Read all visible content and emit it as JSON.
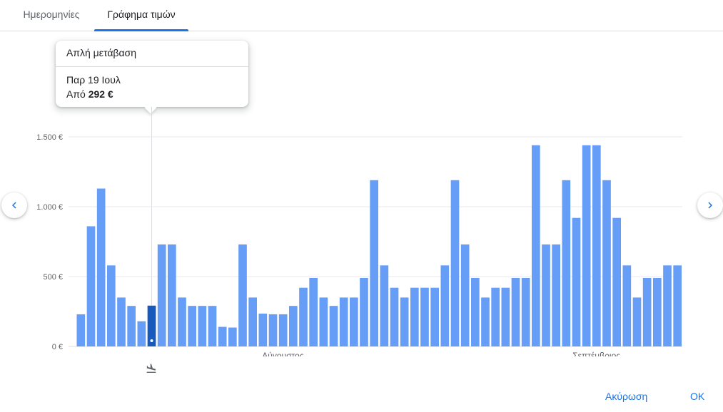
{
  "tabs": [
    {
      "label": "Ημερομηνίες",
      "active": false
    },
    {
      "label": "Γράφημα τιμών",
      "active": true
    }
  ],
  "tooltip": {
    "title": "Απλή μετάβαση",
    "date": "Παρ 19 Ιουλ",
    "price_prefix": "Από",
    "price": "292 €"
  },
  "nav": {
    "prev_icon": "chevron-left-icon",
    "next_icon": "chevron-right-icon"
  },
  "footer": {
    "cancel_label": "Ακύρωση",
    "ok_label": "OK"
  },
  "colors": {
    "bar": "#669df6",
    "bar_selected": "#185abc",
    "accent": "#1a73e8",
    "grid": "#e8eaed"
  },
  "chart_data": {
    "type": "bar",
    "values": [
      230,
      860,
      1130,
      580,
      350,
      290,
      180,
      292,
      730,
      730,
      350,
      290,
      290,
      290,
      140,
      135,
      730,
      350,
      235,
      230,
      230,
      290,
      420,
      490,
      350,
      290,
      350,
      350,
      490,
      1190,
      580,
      420,
      350,
      420,
      420,
      420,
      580,
      1190,
      730,
      490,
      350,
      420,
      420,
      490,
      490,
      1440,
      730,
      730,
      1190,
      920,
      1440,
      1440,
      1190,
      920,
      580,
      350,
      490,
      490,
      580,
      580
    ],
    "selected_index": 7,
    "yticks": [
      {
        "value": 0,
        "label": "0 €"
      },
      {
        "value": 500,
        "label": "500 €"
      },
      {
        "value": 1000,
        "label": "1.000 €"
      },
      {
        "value": 1500,
        "label": "1.500 €"
      }
    ],
    "xlabels": [
      {
        "index": 20,
        "label": "Αύγουστος"
      },
      {
        "index": 51,
        "label": "Σεπτέμβριος"
      }
    ],
    "ylim": [
      0,
      1500
    ],
    "grid": true,
    "marker_icon": "plane-landing-icon"
  }
}
